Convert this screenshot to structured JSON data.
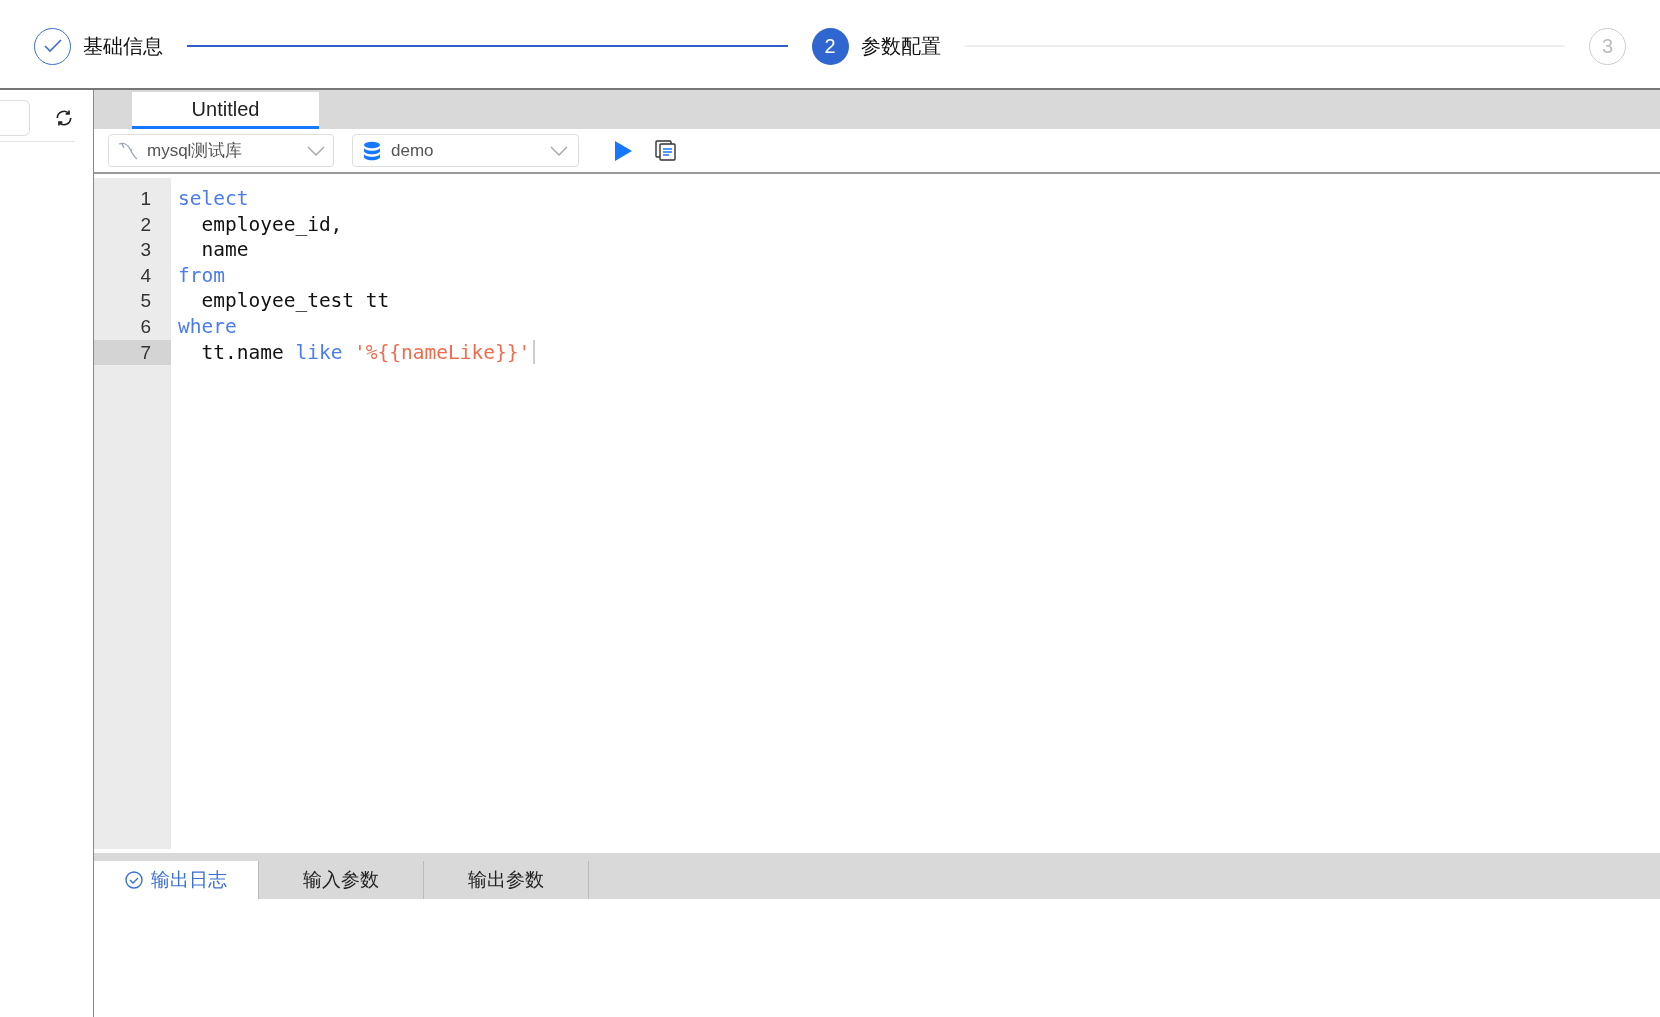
{
  "steps": [
    {
      "label": "基础信息",
      "kind": "done"
    },
    {
      "label": "参数配置",
      "number": "2",
      "kind": "current"
    },
    {
      "number": "3",
      "kind": "waiting"
    }
  ],
  "editor_tabs": [
    {
      "label": "Untitled",
      "selected": true
    }
  ],
  "toolbar": {
    "datasource": "mysql测试库",
    "database": "demo"
  },
  "code_lines": [
    {
      "number": "1",
      "active": false,
      "tokens": [
        {
          "kind": "keyword",
          "text": "select"
        }
      ]
    },
    {
      "number": "2",
      "active": false,
      "tokens": [
        {
          "kind": "plain",
          "text": "  employee_id,"
        }
      ]
    },
    {
      "number": "3",
      "active": false,
      "tokens": [
        {
          "kind": "plain",
          "text": "  name"
        }
      ]
    },
    {
      "number": "4",
      "active": false,
      "tokens": [
        {
          "kind": "keyword",
          "text": "from"
        }
      ]
    },
    {
      "number": "5",
      "active": false,
      "tokens": [
        {
          "kind": "plain",
          "text": "  employee_test tt"
        }
      ]
    },
    {
      "number": "6",
      "active": false,
      "tokens": [
        {
          "kind": "keyword",
          "text": "where"
        }
      ]
    },
    {
      "number": "7",
      "active": true,
      "tokens": [
        {
          "kind": "plain",
          "text": "  tt.name "
        },
        {
          "kind": "keyword",
          "text": "like "
        },
        {
          "kind": "string",
          "text": "'%{{nameLike}}'"
        }
      ]
    }
  ],
  "result_tabs": [
    {
      "label": "输出日志",
      "selected": true
    },
    {
      "label": "输入参数",
      "selected": false
    },
    {
      "label": "输出参数",
      "selected": false
    }
  ]
}
